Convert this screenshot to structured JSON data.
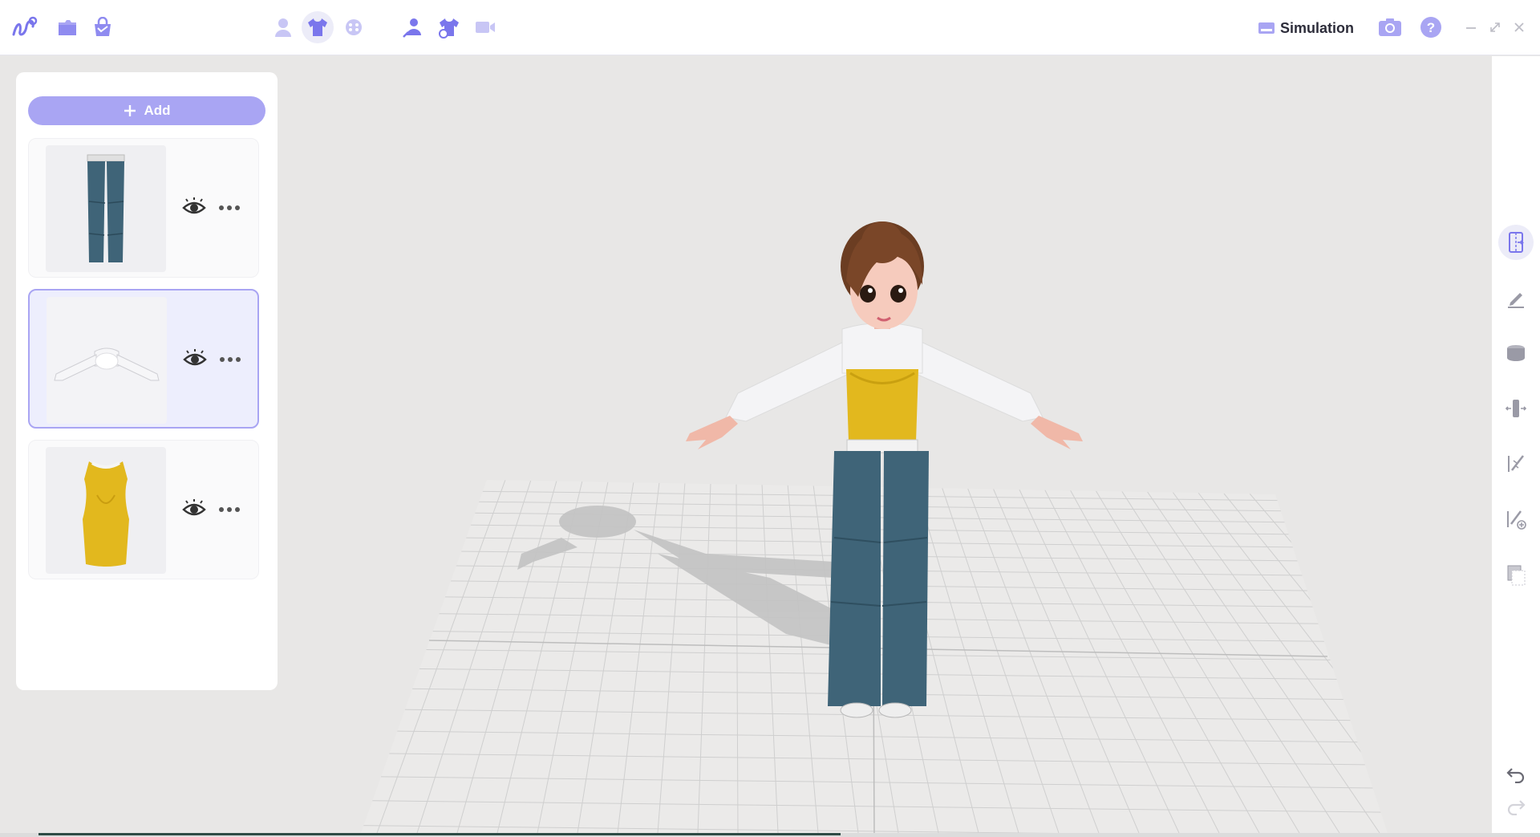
{
  "app": {
    "logo_icon": "clo-logo-icon",
    "accent_color": "#a9a5f3",
    "brand_color": "#6c68e8"
  },
  "toolbar": {
    "left_icons": [
      "folder-icon",
      "shopping-bag-icon"
    ],
    "mode_icons": [
      "avatar-icon",
      "garment-icon",
      "fabric-icon"
    ],
    "tool_icons": [
      "avatar-edit-icon",
      "garment-fit-icon",
      "video-icon"
    ],
    "simulation_label": "Simulation",
    "right_icons": [
      "camera-icon",
      "help-icon",
      "minimize-icon",
      "restore-icon",
      "close-icon"
    ]
  },
  "sidebar": {
    "add_label": "Add",
    "items": [
      {
        "name": "pants",
        "selected": false,
        "visible": true
      },
      {
        "name": "cropped-top",
        "selected": true,
        "visible": true
      },
      {
        "name": "tank-top",
        "selected": false,
        "visible": true
      }
    ]
  },
  "right_tools": [
    "pattern-arrange-icon",
    "edit-pencil-icon",
    "layer-icon",
    "size-adjust-icon",
    "sewing-icon",
    "add-sewing-icon",
    "duplicate-icon",
    "undo-icon",
    "redo-icon"
  ]
}
